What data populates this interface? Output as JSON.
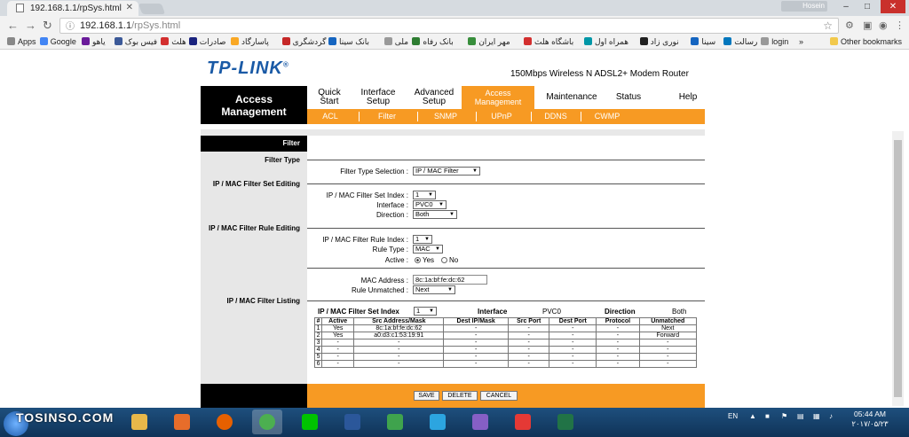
{
  "browser": {
    "tab_title": "192.168.1.1/rpSys.html",
    "profile": "Hosein",
    "url_host": "192.168.1.1",
    "url_path": "/rpSys.html",
    "bookmarks": [
      {
        "label": "Apps",
        "color": "#888888"
      },
      {
        "label": "Google",
        "color": "#4285f4"
      },
      {
        "label": "یاهو",
        "color": "#6a1b9a"
      },
      {
        "label": "فیس بوک",
        "color": "#3b5998"
      },
      {
        "label": "هلث",
        "color": "#d32f2f"
      },
      {
        "label": "صادرات",
        "color": "#1a237e"
      },
      {
        "label": "پاسارگاد",
        "color": "#f9a825"
      },
      {
        "label": "گردشگری",
        "color": "#c62828"
      },
      {
        "label": "بانک سینا",
        "color": "#1565c0"
      },
      {
        "label": "ملی",
        "color": "#999999"
      },
      {
        "label": "بانک رفاه",
        "color": "#2e7d32"
      },
      {
        "label": "مهر ایران",
        "color": "#388e3c"
      },
      {
        "label": "باشگاه هلث",
        "color": "#d32f2f"
      },
      {
        "label": "همراه اول",
        "color": "#0097a7"
      },
      {
        "label": "نوری زاد",
        "color": "#212121"
      },
      {
        "label": "سینا",
        "color": "#1565c0"
      },
      {
        "label": "رسالت",
        "color": "#0277bd"
      },
      {
        "label": "login",
        "color": "#999999"
      }
    ],
    "more_label": "»",
    "other_bookmarks": "Other bookmarks"
  },
  "router": {
    "brand": "TP-LINK",
    "brand_mark": "®",
    "model": "150Mbps Wireless N ADSL2+ Modem Router",
    "section_title_1": "Access",
    "section_title_2": "Management",
    "menu": [
      {
        "l1": "Quick",
        "l2": "Start"
      },
      {
        "l1": "Interface",
        "l2": "Setup"
      },
      {
        "l1": "Advanced",
        "l2": "Setup"
      },
      {
        "l1": "Access",
        "l2": "Management"
      },
      {
        "l1": "Maintenance",
        "l2": ""
      },
      {
        "l1": "Status",
        "l2": ""
      },
      {
        "l1": "Help",
        "l2": ""
      }
    ],
    "submenu": [
      "ACL",
      "Filter",
      "SNMP",
      "UPnP",
      "DDNS",
      "CWMP"
    ],
    "sidebar_head": "Filter",
    "sections": {
      "filter_type": "Filter Type",
      "set_editing": "IP / MAC Filter Set Editing",
      "rule_editing": "IP / MAC Filter Rule Editing",
      "listing": "IP / MAC Filter Listing"
    },
    "form": {
      "filter_type_selection_label": "Filter Type Selection :",
      "filter_type_selection": "IP / MAC Filter",
      "set_index_label": "IP / MAC Filter Set Index :",
      "set_index": "1",
      "interface_label": "Interface :",
      "interface": "PVC0",
      "direction_label": "Direction :",
      "direction": "Both",
      "rule_index_label": "IP / MAC Filter Rule Index :",
      "rule_index": "1",
      "rule_type_label": "Rule Type :",
      "rule_type": "MAC",
      "active_label": "Active :",
      "active_yes": "Yes",
      "active_no": "No",
      "mac_label": "MAC Address :",
      "mac": "8c:1a:bf:fe:dc:62",
      "unmatched_label": "Rule Unmatched :",
      "unmatched": "Next"
    },
    "listing": {
      "set_index_label": "IP / MAC Filter Set Index",
      "set_index": "1",
      "interface_label": "Interface",
      "interface": "PVC0",
      "direction_label": "Direction",
      "direction": "Both",
      "columns": [
        "#",
        "Active",
        "Src Address/Mask",
        "Dest IP/Mask",
        "Src Port",
        "Dest Port",
        "Protocol",
        "Unmatched"
      ],
      "rows": [
        [
          "1",
          "Yes",
          "8c:1a:bf:fe:dc:62",
          "-",
          "-",
          "-",
          "-",
          "Next"
        ],
        [
          "2",
          "Yes",
          "a0:d3:c1:53:19:91",
          "-",
          "-",
          "-",
          "-",
          "Forward"
        ],
        [
          "3",
          "-",
          "-",
          "-",
          "-",
          "-",
          "-",
          "-"
        ],
        [
          "4",
          "-",
          "-",
          "-",
          "-",
          "-",
          "-",
          "-"
        ],
        [
          "5",
          "-",
          "-",
          "-",
          "-",
          "-",
          "-",
          "-"
        ],
        [
          "6",
          "-",
          "-",
          "-",
          "-",
          "-",
          "-",
          "-"
        ]
      ]
    },
    "buttons": {
      "save": "SAVE",
      "delete": "DELETE",
      "cancel": "CANCEL"
    },
    "accent_color": "#f79a23"
  },
  "taskbar": {
    "brand": "TOSINSO.COM",
    "lang": "EN",
    "time": "05:44 AM",
    "date": "۲۰۱۷/۰۵/۲۳",
    "apps": [
      {
        "name": "explorer",
        "color": "#e8b84a"
      },
      {
        "name": "media",
        "color": "#e76d2a"
      },
      {
        "name": "firefox",
        "color": "#e66000"
      },
      {
        "name": "chrome",
        "color": "#4caf50"
      },
      {
        "name": "line",
        "color": "#00c300"
      },
      {
        "name": "word",
        "color": "#2b579a"
      },
      {
        "name": "network",
        "color": "#3fa34d"
      },
      {
        "name": "telegram",
        "color": "#2ca5e0"
      },
      {
        "name": "visual-studio",
        "color": "#865fc5"
      },
      {
        "name": "app-red",
        "color": "#e53935"
      },
      {
        "name": "excel",
        "color": "#217346"
      }
    ]
  }
}
